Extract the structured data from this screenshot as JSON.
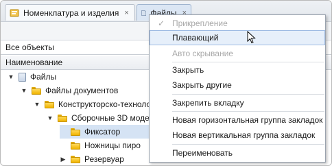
{
  "tabs": [
    {
      "label": "Номенклатура и изделия",
      "close": "×",
      "icon": "nomenclature-icon"
    },
    {
      "label": "Файлы",
      "close": "×",
      "icon": "files-icon"
    }
  ],
  "filter": {
    "value": "Все объекты"
  },
  "column_header": "Наименование",
  "tree": [
    {
      "label": "Файлы",
      "arrow": "▼",
      "icon": "file-icon"
    },
    {
      "label": "Файлы документов",
      "arrow": "▼",
      "icon": "folder-icon"
    },
    {
      "label": "Конструкторско-техноло",
      "arrow": "▼",
      "icon": "folder-icon"
    },
    {
      "label": "Сборочные 3D моде",
      "arrow": "▼",
      "icon": "folder-icon"
    },
    {
      "label": "Фиксатор",
      "arrow": "",
      "icon": "folder-icon",
      "selected": true
    },
    {
      "label": "Ножницы пиро",
      "arrow": "",
      "icon": "folder-icon"
    },
    {
      "label": "Резервуар",
      "arrow": "▶",
      "icon": "folder-icon"
    }
  ],
  "menu": {
    "items": [
      {
        "label": "Прикрепление",
        "disabled": true,
        "checked": true
      },
      {
        "label": "Плавающий",
        "hover": true
      },
      {
        "label": "Авто скрывание",
        "disabled": true
      },
      {
        "label": "Закрыть"
      },
      {
        "label": "Закрыть другие"
      },
      {
        "label": "Закрепить вкладку"
      },
      {
        "label": "Новая горизонтальная группа закладок"
      },
      {
        "label": "Новая вертикальная группа закладок"
      },
      {
        "label": "Переименовать"
      }
    ],
    "check_mark": "✓"
  },
  "colors": {
    "accent": "#9dbbe3",
    "hover_bg": "#e6effa",
    "selected_row": "#d5e3f4",
    "disabled_text": "#a8a8a8"
  }
}
